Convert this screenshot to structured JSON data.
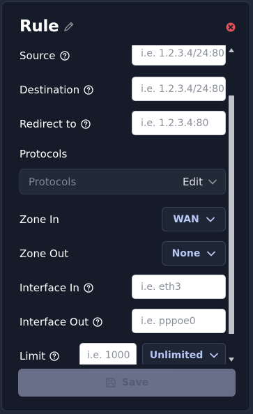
{
  "dialog": {
    "title": "Rule",
    "save_label": "Save"
  },
  "fields": {
    "source": {
      "label": "Source",
      "placeholder": "i.e. 1.2.3.4/24:80"
    },
    "destination": {
      "label": "Destination",
      "placeholder": "i.e. 1.2.3.4/24:80"
    },
    "redirect_to": {
      "label": "Redirect to",
      "placeholder": "i.e. 1.2.3.4:80"
    },
    "protocols": {
      "label": "Protocols",
      "placeholder": "Protocols",
      "edit_label": "Edit"
    },
    "zone_in": {
      "label": "Zone In",
      "value": "WAN"
    },
    "zone_out": {
      "label": "Zone Out",
      "value": "None"
    },
    "interface_in": {
      "label": "Interface In",
      "placeholder": "i.e. eth3"
    },
    "interface_out": {
      "label": "Interface Out",
      "placeholder": "i.e. pppoe0"
    },
    "limit": {
      "label": "Limit",
      "placeholder": "i.e. 1000",
      "unit_value": "Unlimited"
    }
  },
  "colors": {
    "background": "#151b29",
    "close_icon": "#e0525a",
    "select_text": "#b8c6f4",
    "save_disabled": "#868ba8"
  },
  "icons": {
    "edit": "pencil-icon",
    "close": "close-circle-icon",
    "help": "question-circle-icon",
    "dropdown": "chevron-down-icon",
    "save": "floppy-disk-icon"
  }
}
